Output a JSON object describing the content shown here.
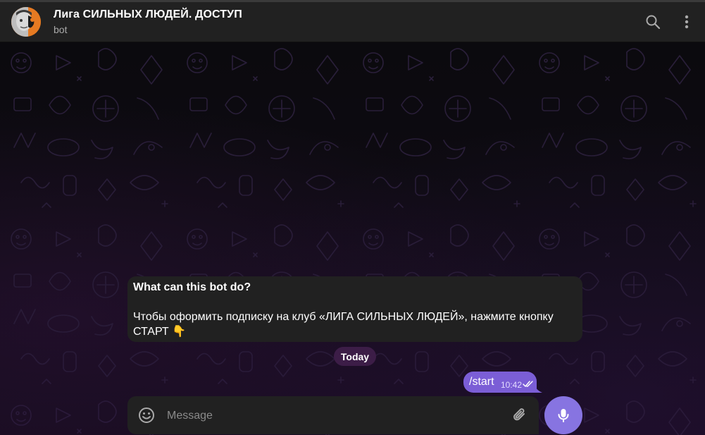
{
  "header": {
    "title": "Лига СИЛЬНЫХ ЛЮДЕЙ. ДОСТУП",
    "subtitle": "bot",
    "avatar_icon": "avatar-icon",
    "search_icon": "search-icon",
    "more_icon": "more-vertical-icon"
  },
  "bot_info": {
    "title": "What can this bot do?",
    "text": "Чтобы оформить подписку на клуб «ЛИГА СИЛЬНЫХ ЛЮДЕЙ», нажмите кнопку СТАРТ 👇"
  },
  "date_separator": "Today",
  "messages": [
    {
      "text": "/start",
      "time": "10:42",
      "status": "read"
    }
  ],
  "composer": {
    "placeholder": "Message",
    "value": "",
    "emoji_icon": "smile-icon",
    "attach_icon": "paperclip-icon",
    "mic_icon": "microphone-icon"
  },
  "colors": {
    "header_bg": "#212121",
    "bubble_in": "#212121",
    "bubble_out": "#7b5ed6",
    "accent": "#8774e1",
    "date_pill": "#3c1d47",
    "avatar_orange": "#e0761f"
  }
}
